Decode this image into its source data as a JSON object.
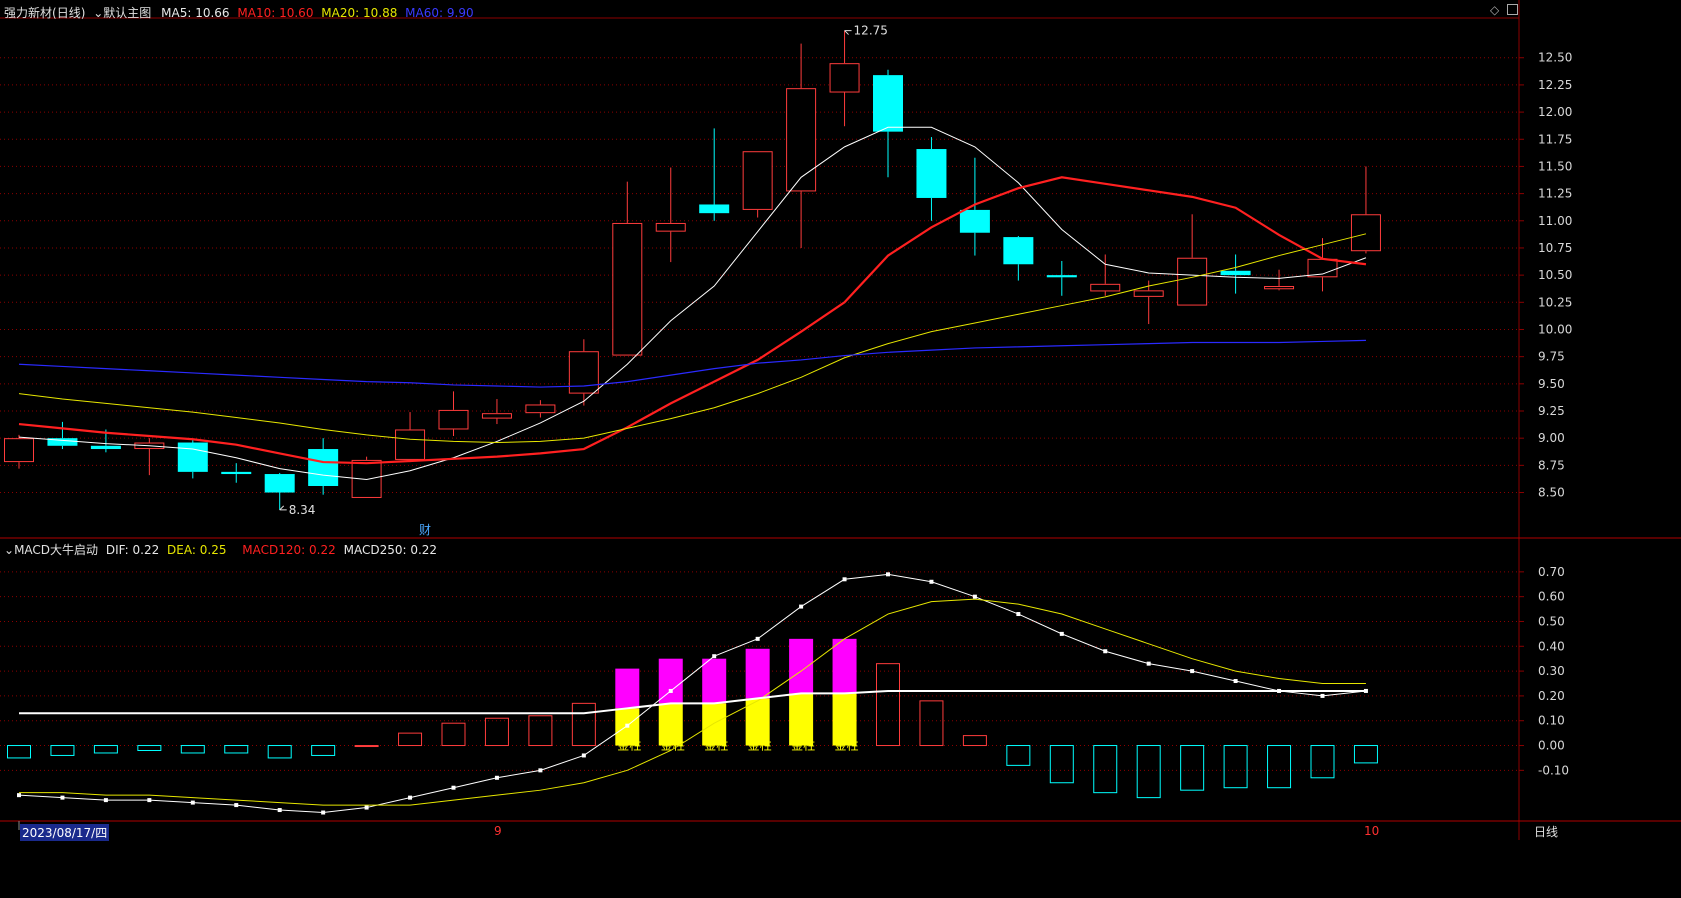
{
  "header": {
    "stock_name": "强力新材",
    "period": "(日线)",
    "template": "默认主图",
    "ma5_label": "MA5:",
    "ma5_value": "10.66",
    "ma10_label": "MA10:",
    "ma10_value": "10.60",
    "ma20_label": "MA20:",
    "ma20_value": "10.88",
    "ma60_label": "MA60:",
    "ma60_value": "9.90"
  },
  "macd_header": {
    "indicator": "MACD大牛启动",
    "dif_label": "DIF:",
    "dif_value": "0.22",
    "dea_label": "DEA:",
    "dea_value": "0.25",
    "macd120_label": "MACD120:",
    "macd120_value": "0.22",
    "macd250_label": "MACD250:",
    "macd250_value": "0.22"
  },
  "footer": {
    "date_label": "2023/08/17/四",
    "month_9": "9",
    "month_10": "10",
    "period_button": "日线"
  },
  "annotations": {
    "high": "12.75",
    "low": "8.34",
    "fin_marker": "财",
    "golden_bar": "金柱"
  },
  "colors": {
    "up": "#ff3c3c",
    "down": "#00ffff",
    "ma5": "#ffffff",
    "ma10": "#ff2020",
    "ma20": "#e6e600",
    "ma60": "#2a2aff",
    "grid": "#8b0000",
    "macd_magenta": "#ff00ff",
    "macd_yellow": "#ffff00"
  },
  "chart_data": [
    {
      "type": "candlestick",
      "ylim": [
        8.1,
        12.7
      ],
      "yticks": [
        8.5,
        8.75,
        9.0,
        9.25,
        9.5,
        9.75,
        10.0,
        10.25,
        10.5,
        10.75,
        11.0,
        11.25,
        11.5,
        11.75,
        12.0,
        12.25,
        12.5
      ],
      "candles": [
        {
          "o": 8.78,
          "h": 9.03,
          "l": 8.72,
          "c": 9.0
        },
        {
          "o": 9.0,
          "h": 9.15,
          "l": 8.9,
          "c": 8.93
        },
        {
          "o": 8.93,
          "h": 9.08,
          "l": 8.87,
          "c": 8.9
        },
        {
          "o": 8.9,
          "h": 9.0,
          "l": 8.66,
          "c": 8.96
        },
        {
          "o": 8.96,
          "h": 8.99,
          "l": 8.63,
          "c": 8.69
        },
        {
          "o": 8.69,
          "h": 8.77,
          "l": 8.59,
          "c": 8.67
        },
        {
          "o": 8.67,
          "h": 8.68,
          "l": 8.34,
          "c": 8.5
        },
        {
          "o": 8.9,
          "h": 9.0,
          "l": 8.48,
          "c": 8.56
        },
        {
          "o": 8.45,
          "h": 8.83,
          "l": 8.45,
          "c": 8.8
        },
        {
          "o": 8.8,
          "h": 9.24,
          "l": 8.78,
          "c": 9.08
        },
        {
          "o": 9.08,
          "h": 9.43,
          "l": 9.02,
          "c": 9.26
        },
        {
          "o": 9.18,
          "h": 9.36,
          "l": 9.13,
          "c": 9.23
        },
        {
          "o": 9.23,
          "h": 9.35,
          "l": 9.19,
          "c": 9.31
        },
        {
          "o": 9.41,
          "h": 9.91,
          "l": 9.3,
          "c": 9.8
        },
        {
          "o": 9.76,
          "h": 11.36,
          "l": 9.76,
          "c": 10.98
        },
        {
          "o": 10.9,
          "h": 11.49,
          "l": 10.62,
          "c": 10.98
        },
        {
          "o": 11.15,
          "h": 11.85,
          "l": 11.0,
          "c": 11.07
        },
        {
          "o": 11.1,
          "h": 11.64,
          "l": 11.03,
          "c": 11.64
        },
        {
          "o": 11.27,
          "h": 12.63,
          "l": 10.75,
          "c": 12.22
        },
        {
          "o": 12.18,
          "h": 12.75,
          "l": 11.87,
          "c": 12.45
        },
        {
          "o": 12.34,
          "h": 12.39,
          "l": 11.4,
          "c": 11.82
        },
        {
          "o": 11.66,
          "h": 11.77,
          "l": 11.0,
          "c": 11.21
        },
        {
          "o": 11.1,
          "h": 11.58,
          "l": 10.68,
          "c": 10.89
        },
        {
          "o": 10.85,
          "h": 10.86,
          "l": 10.45,
          "c": 10.6
        },
        {
          "o": 10.5,
          "h": 10.63,
          "l": 10.31,
          "c": 10.48
        },
        {
          "o": 10.35,
          "h": 10.69,
          "l": 10.31,
          "c": 10.42
        },
        {
          "o": 10.3,
          "h": 10.45,
          "l": 10.05,
          "c": 10.36
        },
        {
          "o": 10.22,
          "h": 11.06,
          "l": 10.22,
          "c": 10.66
        },
        {
          "o": 10.54,
          "h": 10.69,
          "l": 10.33,
          "c": 10.5
        },
        {
          "o": 10.37,
          "h": 10.55,
          "l": 10.36,
          "c": 10.4
        },
        {
          "o": 10.48,
          "h": 10.84,
          "l": 10.35,
          "c": 10.65
        },
        {
          "o": 10.72,
          "h": 11.5,
          "l": 10.7,
          "c": 11.06
        }
      ],
      "series": [
        {
          "name": "MA5",
          "values": [
            9.01,
            8.98,
            8.95,
            8.93,
            8.9,
            8.82,
            8.72,
            8.66,
            8.62,
            8.7,
            8.82,
            8.97,
            9.14,
            9.34,
            9.68,
            10.08,
            10.4,
            10.9,
            11.4,
            11.68,
            11.86,
            11.86,
            11.68,
            11.35,
            10.92,
            10.6,
            10.52,
            10.5,
            10.48,
            10.47,
            10.51,
            10.66
          ]
        },
        {
          "name": "MA10",
          "values": [
            9.13,
            9.09,
            9.05,
            9.02,
            8.99,
            8.94,
            8.86,
            8.78,
            8.77,
            8.79,
            8.81,
            8.83,
            8.86,
            8.9,
            9.1,
            9.32,
            9.52,
            9.72,
            9.98,
            10.25,
            10.68,
            10.94,
            11.15,
            11.3,
            11.4,
            11.34,
            11.28,
            11.22,
            11.12,
            10.87,
            10.65,
            10.6
          ]
        },
        {
          "name": "MA20",
          "values": [
            9.41,
            9.36,
            9.32,
            9.28,
            9.24,
            9.19,
            9.14,
            9.08,
            9.03,
            8.99,
            8.97,
            8.96,
            8.97,
            9.0,
            9.09,
            9.18,
            9.28,
            9.41,
            9.56,
            9.74,
            9.87,
            9.98,
            10.06,
            10.14,
            10.22,
            10.3,
            10.4,
            10.48,
            10.57,
            10.68,
            10.78,
            10.88
          ]
        },
        {
          "name": "MA60",
          "values": [
            9.68,
            9.66,
            9.64,
            9.62,
            9.6,
            9.58,
            9.56,
            9.54,
            9.52,
            9.51,
            9.49,
            9.48,
            9.47,
            9.48,
            9.52,
            9.58,
            9.64,
            9.69,
            9.72,
            9.76,
            9.79,
            9.81,
            9.83,
            9.84,
            9.85,
            9.86,
            9.87,
            9.88,
            9.88,
            9.88,
            9.89,
            9.9
          ]
        }
      ]
    },
    {
      "type": "macd",
      "ylim": [
        -0.28,
        0.78
      ],
      "yticks": [
        -0.1,
        0.0,
        0.1,
        0.2,
        0.3,
        0.4,
        0.5,
        0.6,
        0.7
      ],
      "histogram": [
        -0.05,
        -0.04,
        -0.03,
        -0.02,
        -0.03,
        -0.03,
        -0.05,
        -0.04,
        0.0,
        0.05,
        0.09,
        0.11,
        0.12,
        0.17,
        0.31,
        0.35,
        0.35,
        0.39,
        0.43,
        0.43,
        0.33,
        0.18,
        0.04,
        -0.08,
        -0.15,
        -0.19,
        -0.21,
        -0.18,
        -0.17,
        -0.17,
        -0.13,
        -0.07
      ],
      "golden_bar_lower": [
        null,
        null,
        null,
        null,
        null,
        null,
        null,
        null,
        null,
        null,
        null,
        null,
        null,
        null,
        0.15,
        0.17,
        0.17,
        0.19,
        0.21,
        0.21,
        null,
        null,
        null,
        null,
        null,
        null,
        null,
        null,
        null,
        null,
        null,
        null
      ],
      "golden_indices": [
        14,
        15,
        16,
        17,
        18,
        19
      ],
      "series": [
        {
          "name": "DIF",
          "values": [
            -0.2,
            -0.21,
            -0.22,
            -0.22,
            -0.23,
            -0.24,
            -0.26,
            -0.27,
            -0.25,
            -0.21,
            -0.17,
            -0.13,
            -0.1,
            -0.04,
            0.08,
            0.22,
            0.36,
            0.43,
            0.56,
            0.67,
            0.69,
            0.66,
            0.6,
            0.53,
            0.45,
            0.38,
            0.33,
            0.3,
            0.26,
            0.22,
            0.2,
            0.22
          ]
        },
        {
          "name": "DEA",
          "values": [
            -0.19,
            -0.19,
            -0.2,
            -0.2,
            -0.21,
            -0.22,
            -0.23,
            -0.24,
            -0.24,
            -0.24,
            -0.22,
            -0.2,
            -0.18,
            -0.15,
            -0.1,
            -0.02,
            0.09,
            0.18,
            0.3,
            0.43,
            0.53,
            0.58,
            0.59,
            0.57,
            0.53,
            0.47,
            0.41,
            0.35,
            0.3,
            0.27,
            0.25,
            0.25
          ]
        },
        {
          "name": "MACD120",
          "values": [
            0.13,
            0.13,
            0.13,
            0.13,
            0.13,
            0.13,
            0.13,
            0.13,
            0.13,
            0.13,
            0.13,
            0.13,
            0.13,
            0.13,
            0.15,
            0.17,
            0.17,
            0.19,
            0.21,
            0.21,
            0.22,
            0.22,
            0.22,
            0.22,
            0.22,
            0.22,
            0.22,
            0.22,
            0.22,
            0.22,
            0.22,
            0.22
          ]
        }
      ]
    }
  ]
}
